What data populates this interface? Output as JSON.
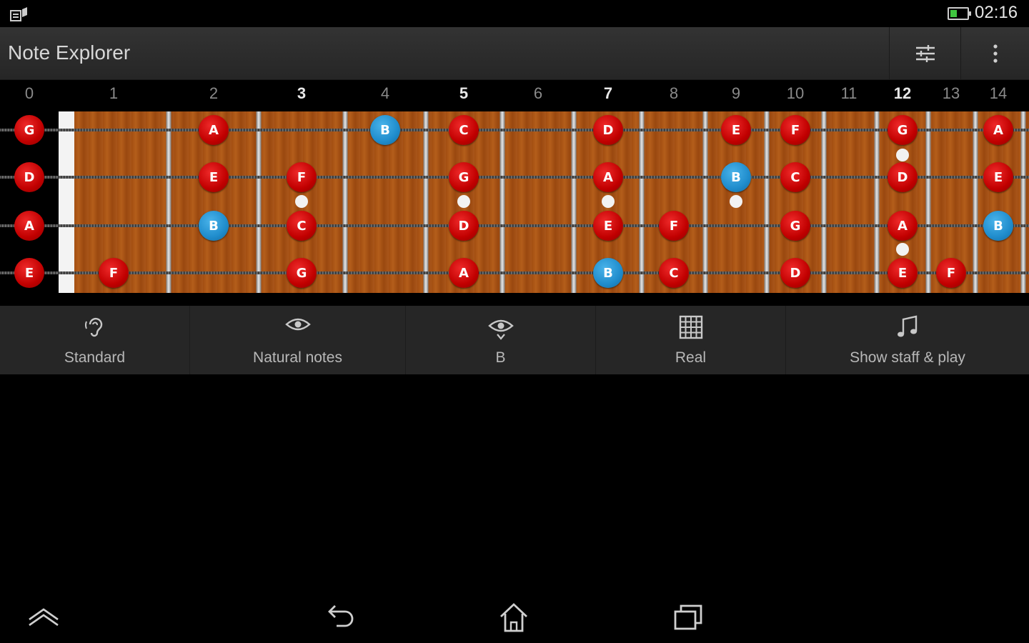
{
  "status_bar": {
    "time": "02:16",
    "left_icon": "notification-icon",
    "battery_icon": "battery-icon",
    "battery_level": 0.4,
    "battery_color": "#3fc53f"
  },
  "app_bar": {
    "title": "Note Explorer",
    "actions": [
      "tuning-settings-icon",
      "overflow-menu-icon"
    ]
  },
  "fretboard": {
    "fret_numbers": [
      "0",
      "1",
      "2",
      "3",
      "4",
      "5",
      "6",
      "7",
      "8",
      "9",
      "10",
      "11",
      "12",
      "13",
      "14"
    ],
    "marker_frets": [
      "3",
      "5",
      "7",
      "12"
    ],
    "strings": [
      {
        "open": "G",
        "notes": [
          {
            "fret": 2,
            "note": "A"
          },
          {
            "fret": 4,
            "note": "B"
          },
          {
            "fret": 5,
            "note": "C"
          },
          {
            "fret": 7,
            "note": "D"
          },
          {
            "fret": 9,
            "note": "E"
          },
          {
            "fret": 10,
            "note": "F"
          },
          {
            "fret": 12,
            "note": "G"
          },
          {
            "fret": 14,
            "note": "A"
          }
        ]
      },
      {
        "open": "D",
        "notes": [
          {
            "fret": 2,
            "note": "E"
          },
          {
            "fret": 3,
            "note": "F"
          },
          {
            "fret": 5,
            "note": "G"
          },
          {
            "fret": 7,
            "note": "A"
          },
          {
            "fret": 9,
            "note": "B"
          },
          {
            "fret": 10,
            "note": "C"
          },
          {
            "fret": 12,
            "note": "D"
          },
          {
            "fret": 14,
            "note": "E"
          }
        ]
      },
      {
        "open": "A",
        "notes": [
          {
            "fret": 2,
            "note": "B"
          },
          {
            "fret": 3,
            "note": "C"
          },
          {
            "fret": 5,
            "note": "D"
          },
          {
            "fret": 7,
            "note": "E"
          },
          {
            "fret": 8,
            "note": "F"
          },
          {
            "fret": 10,
            "note": "G"
          },
          {
            "fret": 12,
            "note": "A"
          },
          {
            "fret": 14,
            "note": "B"
          }
        ]
      },
      {
        "open": "E",
        "notes": [
          {
            "fret": 1,
            "note": "F"
          },
          {
            "fret": 3,
            "note": "G"
          },
          {
            "fret": 5,
            "note": "A"
          },
          {
            "fret": 7,
            "note": "B"
          },
          {
            "fret": 8,
            "note": "C"
          },
          {
            "fret": 10,
            "note": "D"
          },
          {
            "fret": 12,
            "note": "E"
          },
          {
            "fret": 13,
            "note": "F"
          }
        ]
      }
    ],
    "highlight_note": "B",
    "colors": {
      "note": "#c10000",
      "highlight": "#1f8ccc",
      "wood": "#a9561a"
    }
  },
  "toolbar": {
    "items": [
      {
        "label": "Standard",
        "icon": "ear-icon"
      },
      {
        "label": "Natural notes",
        "icon": "eye-icon"
      },
      {
        "label": "B",
        "icon": "eye-focus-icon"
      },
      {
        "label": "Real",
        "icon": "grid-icon"
      },
      {
        "label": "Show staff & play",
        "icon": "music-note-icon"
      }
    ]
  },
  "nav_bar": {
    "buttons": [
      "expand-icon",
      "back-icon",
      "home-icon",
      "recents-icon"
    ]
  }
}
